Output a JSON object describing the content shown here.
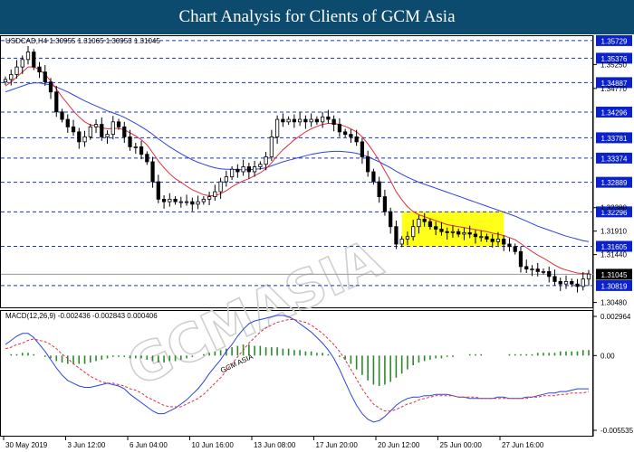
{
  "header": {
    "title": "Chart Analysis for Clients of GCM Asia"
  },
  "watermark": {
    "text": "GCMASIA",
    "sub": "GCM ASIA"
  },
  "colors": {
    "header_bg": "#0c4a6e",
    "level_label_bg": "#0b22c8",
    "ma_fast": "#e0303d",
    "ma_slow": "#2b43e0",
    "highlight": "#ffff00",
    "macd_hist": "#2a8a2a",
    "macd_line": "#2b43e0",
    "signal_line": "#e0303d"
  },
  "chart_data": [
    {
      "type": "candlestick",
      "symbol_info": "USDCAD,H4  1.30955 1.31065 1.30953 1.31045",
      "ylim": [
        1.304,
        1.358
      ],
      "x_tick_labels": [
        "30 May 2019",
        "3 Jun 12:00",
        "6 Jun 04:00",
        "10 Jun 16:00",
        "13 Jun 08:00",
        "17 Jun 20:00",
        "20 Jun 12:00",
        "25 Jun 00:00",
        "27 Jun 16:00"
      ],
      "y_tick_labels": [
        "1.35250",
        "1.34770",
        "1.32380",
        "1.31910",
        "1.31440",
        "1.30480"
      ],
      "levels": [
        1.35729,
        1.35376,
        1.34887,
        1.34296,
        1.33781,
        1.33374,
        1.32889,
        1.32296,
        1.31605,
        1.30819
      ],
      "level_labels": [
        "1.35729",
        "1.35376",
        "1.34887",
        "1.34296",
        "1.33781",
        "1.33374",
        "1.32889",
        "1.32296",
        "1.31605",
        "1.30819"
      ],
      "current_price": 1.31045,
      "current_price_label": "1.31045",
      "highlight_zone": {
        "y_range": [
          1.316,
          1.323
        ],
        "from_candle": 70,
        "to_candle": 88
      },
      "close": [
        1.3495,
        1.3505,
        1.352,
        1.3535,
        1.355,
        1.352,
        1.351,
        1.349,
        1.347,
        1.343,
        1.3415,
        1.34,
        1.339,
        1.337,
        1.338,
        1.34,
        1.3405,
        1.338,
        1.3385,
        1.341,
        1.34,
        1.338,
        1.336,
        1.336,
        1.3345,
        1.333,
        1.329,
        1.3255,
        1.325,
        1.3255,
        1.325,
        1.325,
        1.325,
        1.3245,
        1.325,
        1.3255,
        1.326,
        1.327,
        1.329,
        1.33,
        1.3315,
        1.331,
        1.332,
        1.331,
        1.332,
        1.3325,
        1.334,
        1.338,
        1.3415,
        1.341,
        1.3415,
        1.341,
        1.3415,
        1.341,
        1.3415,
        1.341,
        1.342,
        1.3415,
        1.3405,
        1.339,
        1.3385,
        1.338,
        1.337,
        1.334,
        1.331,
        1.329,
        1.326,
        1.323,
        1.32,
        1.3165,
        1.3175,
        1.318,
        1.32,
        1.3215,
        1.321,
        1.32,
        1.3195,
        1.319,
        1.3188,
        1.319,
        1.3185,
        1.3188,
        1.3185,
        1.318,
        1.318,
        1.3175,
        1.317,
        1.3175,
        1.3165,
        1.316,
        1.315,
        1.312,
        1.3115,
        1.3115,
        1.311,
        1.311,
        1.31,
        1.309,
        1.3085,
        1.309,
        1.3085,
        1.308,
        1.3095,
        1.3105
      ],
      "ma_fast": [
        1.3482,
        1.349,
        1.35,
        1.351,
        1.352,
        1.352,
        1.3515,
        1.3505,
        1.3492,
        1.3476,
        1.346,
        1.3446,
        1.3432,
        1.342,
        1.341,
        1.3404,
        1.3402,
        1.3398,
        1.3396,
        1.3397,
        1.3397,
        1.3394,
        1.3388,
        1.3382,
        1.3374,
        1.3364,
        1.3348,
        1.3332,
        1.3318,
        1.3306,
        1.3296,
        1.3289,
        1.3281,
        1.3274,
        1.3269,
        1.3264,
        1.3262,
        1.3262,
        1.3266,
        1.3272,
        1.328,
        1.3286,
        1.3292,
        1.3296,
        1.3302,
        1.3308,
        1.3316,
        1.3328,
        1.3342,
        1.3354,
        1.3364,
        1.3374,
        1.3382,
        1.339,
        1.3396,
        1.3401,
        1.3405,
        1.3407,
        1.3407,
        1.3405,
        1.3401,
        1.3396,
        1.339,
        1.338,
        1.3366,
        1.335,
        1.3332,
        1.3312,
        1.3292,
        1.327,
        1.3254,
        1.324,
        1.323,
        1.3224,
        1.322,
        1.3216,
        1.3212,
        1.3208,
        1.3204,
        1.3202,
        1.32,
        1.3198,
        1.3196,
        1.3194,
        1.3192,
        1.319,
        1.3187,
        1.3185,
        1.3182,
        1.3178,
        1.3174,
        1.3166,
        1.3158,
        1.315,
        1.3143,
        1.3137,
        1.313,
        1.3123,
        1.3117,
        1.3113,
        1.311,
        1.3107,
        1.3106,
        1.3106
      ],
      "ma_slow": [
        1.347,
        1.3474,
        1.3478,
        1.3482,
        1.3486,
        1.3488,
        1.3488,
        1.3486,
        1.3484,
        1.348,
        1.3475,
        1.347,
        1.3464,
        1.3458,
        1.3452,
        1.3447,
        1.3442,
        1.3437,
        1.3432,
        1.3428,
        1.3424,
        1.3419,
        1.3413,
        1.3407,
        1.34,
        1.3393,
        1.3385,
        1.3376,
        1.3368,
        1.336,
        1.3353,
        1.3346,
        1.334,
        1.3334,
        1.3329,
        1.3325,
        1.3321,
        1.3318,
        1.3316,
        1.3315,
        1.3315,
        1.3314,
        1.3314,
        1.3314,
        1.3315,
        1.3316,
        1.3318,
        1.3322,
        1.3326,
        1.333,
        1.3333,
        1.3336,
        1.3339,
        1.3342,
        1.3345,
        1.3347,
        1.3349,
        1.335,
        1.3351,
        1.3351,
        1.335,
        1.3349,
        1.3347,
        1.3344,
        1.334,
        1.3335,
        1.333,
        1.3324,
        1.3318,
        1.3311,
        1.3305,
        1.3299,
        1.3294,
        1.3289,
        1.3285,
        1.3281,
        1.3277,
        1.3273,
        1.3269,
        1.3265,
        1.3261,
        1.3257,
        1.3253,
        1.3249,
        1.3245,
        1.3241,
        1.3237,
        1.3233,
        1.3229,
        1.3225,
        1.3221,
        1.3216,
        1.3211,
        1.3206,
        1.3201,
        1.3197,
        1.3193,
        1.3189,
        1.3185,
        1.3181,
        1.3178,
        1.3175,
        1.3172,
        1.317
      ]
    },
    {
      "type": "macd",
      "label": "MACD(12,26,9) -0.002436 -0.002843 0.000406",
      "ylim": [
        -0.00553,
        0.00296
      ],
      "y_tick_labels": [
        "0.002964",
        "0.00",
        "-0.005535"
      ],
      "histogram": [
        0.0,
        0.0001,
        0.0001,
        0.0002,
        0.0002,
        0.0001,
        0.0,
        -0.0001,
        -0.0002,
        -0.0004,
        -0.0005,
        -0.0006,
        -0.0006,
        -0.0006,
        -0.0006,
        -0.0005,
        -0.0004,
        -0.0003,
        -0.0002,
        -0.0001,
        -0.0001,
        -0.0001,
        -0.0002,
        -0.0002,
        -0.0002,
        -0.0003,
        -0.0004,
        -0.0005,
        -0.0005,
        -0.0004,
        -0.0004,
        -0.0003,
        -0.0002,
        -0.0001,
        0.0,
        0.0001,
        0.0002,
        0.0003,
        0.0004,
        0.0005,
        0.0006,
        0.0007,
        0.0008,
        0.0008,
        0.0007,
        0.0007,
        0.0006,
        0.0006,
        0.0006,
        0.0005,
        0.0005,
        0.0004,
        0.0004,
        0.0003,
        0.0003,
        0.0002,
        0.0002,
        0.0001,
        0.0,
        -0.0001,
        -0.0003,
        -0.0006,
        -0.001,
        -0.0014,
        -0.0018,
        -0.0021,
        -0.0022,
        -0.0021,
        -0.0019,
        -0.0016,
        -0.0013,
        -0.001,
        -0.0007,
        -0.0005,
        -0.0004,
        -0.0003,
        -0.0002,
        -0.0002,
        -0.0001,
        -0.0001,
        0.0,
        0.0,
        0.0001,
        0.0001,
        0.0001,
        0.0,
        0.0,
        0.0,
        0.0,
        0.0001,
        0.0001,
        0.0001,
        0.0001,
        0.0001,
        0.0002,
        0.0002,
        0.0002,
        0.0002,
        0.0003,
        0.0003,
        0.0003,
        0.0003,
        0.0004,
        0.0004
      ],
      "macd": [
        0.0008,
        0.0011,
        0.0014,
        0.0016,
        0.0016,
        0.0013,
        0.0008,
        0.0003,
        -0.0003,
        -0.0009,
        -0.0014,
        -0.0018,
        -0.002,
        -0.0022,
        -0.0023,
        -0.0023,
        -0.0022,
        -0.0021,
        -0.002,
        -0.0021,
        -0.0022,
        -0.0024,
        -0.0028,
        -0.0031,
        -0.0034,
        -0.0037,
        -0.004,
        -0.0042,
        -0.0042,
        -0.004,
        -0.0038,
        -0.0035,
        -0.0032,
        -0.0028,
        -0.0024,
        -0.0019,
        -0.0013,
        -0.0008,
        -0.0003,
        0.0003,
        0.0008,
        0.0014,
        0.0019,
        0.0023,
        0.0025,
        0.0026,
        0.0027,
        0.0028,
        0.0029,
        0.0029,
        0.0028,
        0.0026,
        0.0023,
        0.002,
        0.0017,
        0.0013,
        0.0009,
        0.0004,
        -0.0002,
        -0.001,
        -0.0019,
        -0.0028,
        -0.0036,
        -0.0042,
        -0.0046,
        -0.0048,
        -0.0047,
        -0.0044,
        -0.004,
        -0.0036,
        -0.0033,
        -0.0031,
        -0.003,
        -0.003,
        -0.0029,
        -0.0029,
        -0.0028,
        -0.0028,
        -0.0028,
        -0.0029,
        -0.003,
        -0.003,
        -0.0031,
        -0.0031,
        -0.0031,
        -0.0031,
        -0.0031,
        -0.003,
        -0.003,
        -0.0031,
        -0.0031,
        -0.0031,
        -0.003,
        -0.003,
        -0.0029,
        -0.0028,
        -0.0027,
        -0.0027,
        -0.0026,
        -0.0026,
        -0.0025,
        -0.0024,
        -0.0024,
        -0.0024
      ],
      "signal": [
        0.0005,
        0.0006,
        0.0008,
        0.0009,
        0.0011,
        0.0012,
        0.0011,
        0.001,
        0.0008,
        0.0005,
        0.0001,
        -0.0002,
        -0.0006,
        -0.0009,
        -0.0012,
        -0.0015,
        -0.0017,
        -0.0019,
        -0.002,
        -0.002,
        -0.0021,
        -0.0022,
        -0.0024,
        -0.0025,
        -0.0027,
        -0.003,
        -0.0032,
        -0.0034,
        -0.0036,
        -0.0037,
        -0.0037,
        -0.0037,
        -0.0035,
        -0.0033,
        -0.0031,
        -0.0028,
        -0.0024,
        -0.002,
        -0.0016,
        -0.0011,
        -0.0006,
        -0.0001,
        0.0004,
        0.0009,
        0.0013,
        0.0017,
        0.002,
        0.0022,
        0.0024,
        0.0025,
        0.0026,
        0.0026,
        0.0025,
        0.0024,
        0.0022,
        0.0019,
        0.0016,
        0.0012,
        0.0008,
        0.0003,
        -0.0003,
        -0.001,
        -0.0017,
        -0.0024,
        -0.003,
        -0.0035,
        -0.0038,
        -0.004,
        -0.004,
        -0.0039,
        -0.0037,
        -0.0035,
        -0.0034,
        -0.0032,
        -0.0031,
        -0.003,
        -0.0029,
        -0.0029,
        -0.0029,
        -0.0029,
        -0.003,
        -0.003,
        -0.003,
        -0.003,
        -0.0031,
        -0.0031,
        -0.0031,
        -0.0031,
        -0.0031,
        -0.0031,
        -0.0031,
        -0.0031,
        -0.0031,
        -0.003,
        -0.003,
        -0.0029,
        -0.0029,
        -0.0029,
        -0.0028,
        -0.0028,
        -0.0027,
        -0.0027,
        -0.0027,
        -0.0026
      ]
    }
  ]
}
